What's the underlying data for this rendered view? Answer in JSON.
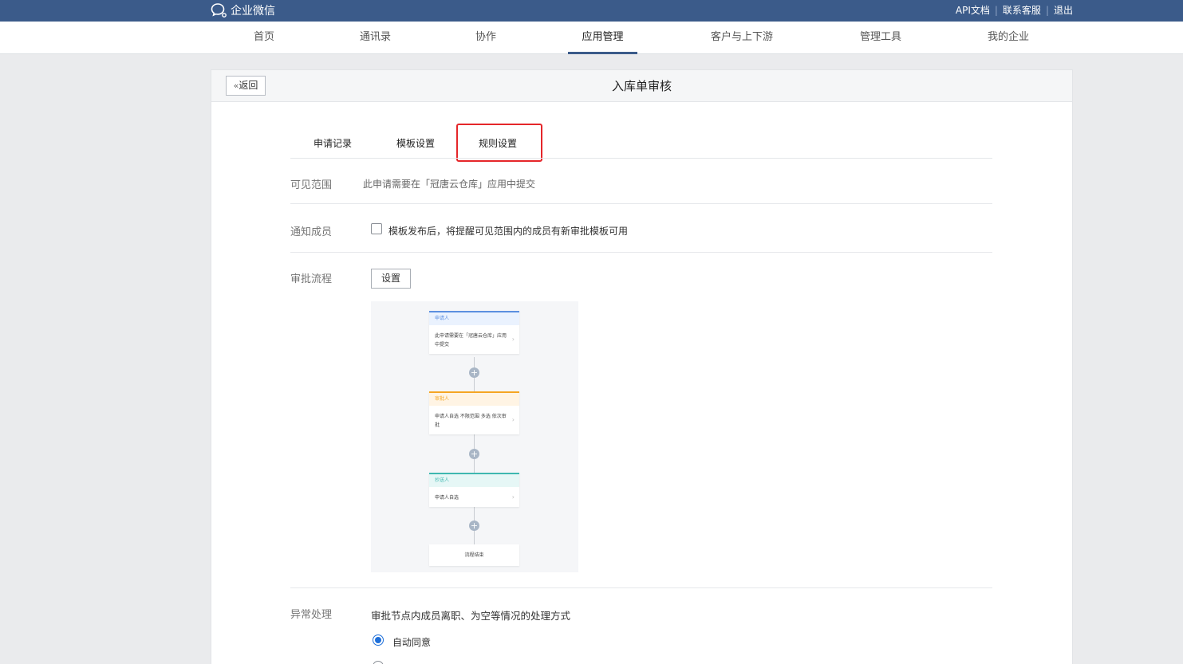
{
  "topbar": {
    "brand": "企业微信",
    "links": [
      "API文档",
      "联系客服",
      "退出"
    ]
  },
  "nav": {
    "items": [
      "首页",
      "通讯录",
      "协作",
      "应用管理",
      "客户与上下游",
      "管理工具",
      "我的企业"
    ],
    "active": "应用管理"
  },
  "panel": {
    "back": "返回",
    "title": "入库单审核"
  },
  "tabs": [
    "申请记录",
    "模板设置",
    "规则设置"
  ],
  "rows": {
    "visible": {
      "label": "可见范围",
      "text": "此申请需要在「冠唐云仓库」应用中提交"
    },
    "notify": {
      "label": "通知成员",
      "text": "模板发布后，将提醒可见范围内的成员有新审批模板可用",
      "checked": false
    },
    "flow": {
      "label": "审批流程",
      "button": "设置"
    },
    "exception": {
      "label": "异常处理",
      "text": "审批节点内成员离职、为空等情况的处理方式",
      "option": "自动同意"
    }
  },
  "flowchart": {
    "nodes": [
      {
        "title": "申请人",
        "body": "此申请需要在「冠唐云仓库」应用中提交",
        "color": "#5b8fe0",
        "headbg": "#eaf2fe"
      },
      {
        "title": "审批人",
        "body": "申请人自选 不限范围 多选 依次审批",
        "color": "#f5a623",
        "headbg": "#fff4e4"
      },
      {
        "title": "抄送人",
        "body": "申请人自选",
        "color": "#3fb8b0",
        "headbg": "#e6f7f6"
      }
    ],
    "end": "流程结束"
  },
  "colors": {
    "topbar": "#3b5b8a",
    "highlight": "#e5262a",
    "radio": "#1e6fd9"
  }
}
